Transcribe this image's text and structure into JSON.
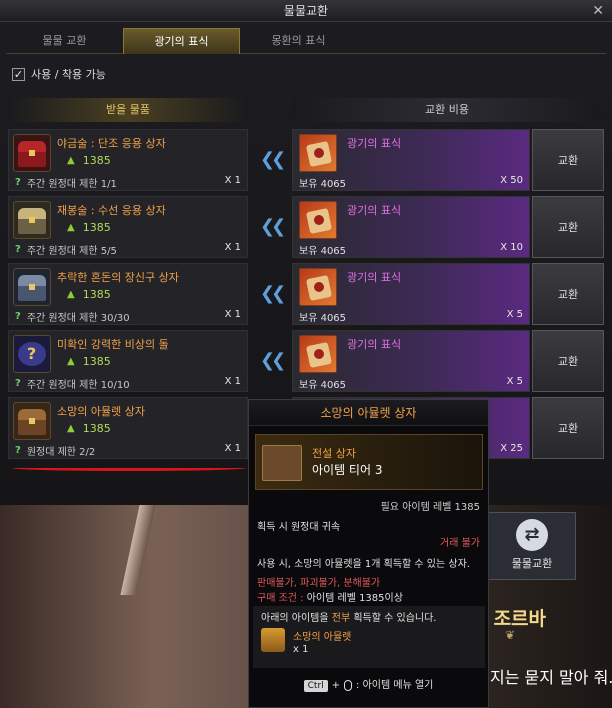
{
  "window": {
    "title": "물물교환",
    "close": "✕"
  },
  "tabs": [
    {
      "label": "물물 교환",
      "active": false
    },
    {
      "label": "광기의 표식",
      "active": true
    },
    {
      "label": "몽환의 표식",
      "active": false
    }
  ],
  "filter": {
    "label": "사용 / 착용 가능",
    "checked": true
  },
  "columns": {
    "receive": "받을 물품",
    "cost": "교환 비용"
  },
  "rows": [
    {
      "name": "야금술 : 단조 응용 상자",
      "level": "1385",
      "limit": "주간 원정대 제한 1/1",
      "qty": "X 1",
      "cost_name": "광기의 표식",
      "owned": "보유 4065",
      "cost_qty": "X 50",
      "button": "교환",
      "icon_color": "red"
    },
    {
      "name": "재봉술 : 수선 응용 상자",
      "level": "1385",
      "limit": "주간 원정대 제한 5/5",
      "qty": "X 1",
      "cost_name": "광기의 표식",
      "owned": "보유 4065",
      "cost_qty": "X 10",
      "button": "교환",
      "icon_color": "gold"
    },
    {
      "name": "추락한 혼돈의 장신구 상자",
      "level": "1385",
      "limit": "주간 원정대 제한 30/30",
      "qty": "X 1",
      "cost_name": "광기의 표식",
      "owned": "보유 4065",
      "cost_qty": "X 5",
      "button": "교환",
      "icon_color": "steel"
    },
    {
      "name": "미확인 강력한 비상의 돌",
      "level": "1385",
      "limit": "주간 원정대 제한 10/10",
      "qty": "X 1",
      "cost_name": "광기의 표식",
      "owned": "보유 4065",
      "cost_qty": "X 5",
      "button": "교환",
      "icon_color": "purple"
    },
    {
      "name": "소망의 아뮬렛 상자",
      "level": "1385",
      "limit": "원정대 제한 2/2",
      "qty": "X 1",
      "cost_name": "",
      "owned": "",
      "cost_qty": "X 25",
      "button": "교환",
      "icon_color": "brown"
    }
  ],
  "tooltip": {
    "title": "소망의 아뮬렛 상자",
    "grade": "전설 상자",
    "tier": "아이템 티어 3",
    "required_level": "필요 아이템 레벨 1385",
    "bind": "획득 시 원정대 귀속",
    "untradable": "거래 불가",
    "description": "사용 시, 소망의 아뮬렛을 1개 획득할 수 있는 상자.",
    "flags": "판매불가, 파괴불가, 분해불가",
    "condition_label": "구매 조건 :",
    "condition_value": " 아이템 레벨 1385이상",
    "list_title_a": "아래의 아이템을 ",
    "list_title_hl": "전부",
    "list_title_b": " 획득할 수 있습니다.",
    "list_item_name": "소망의 아뮬렛",
    "list_item_qty": "x 1",
    "footer_key": "Ctrl",
    "footer_plus": "+",
    "footer_text": ": 아이템 메뉴 열기"
  },
  "scene": {
    "trade_label": "물물교환",
    "npc_name": "집가 조르바",
    "dialog": "지는 묻지 말아 줘."
  },
  "colors": {
    "accent_gold": "#e6c36a",
    "item_orange": "#f0a24a",
    "currency_purple": "#e070e0",
    "underline_red": "#d8141c"
  }
}
